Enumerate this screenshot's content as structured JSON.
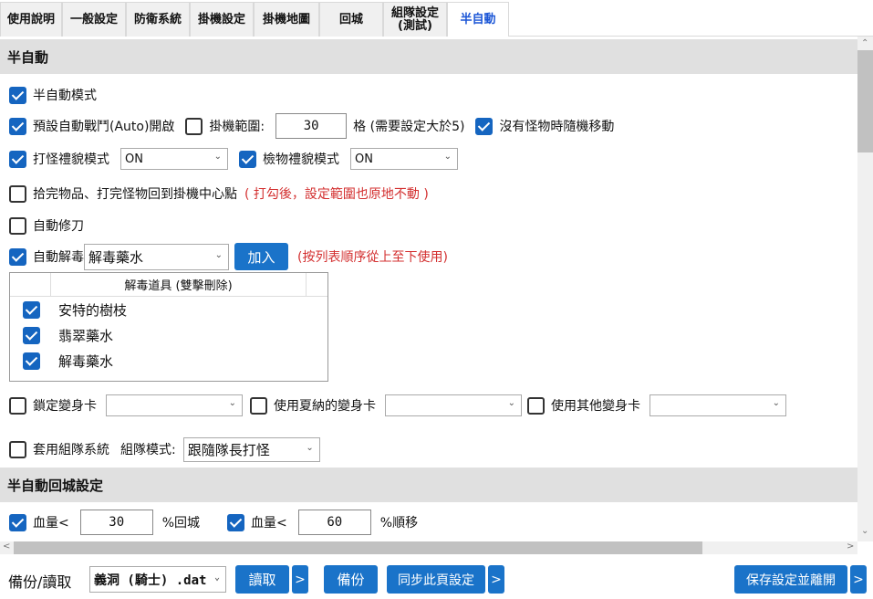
{
  "tabs": [
    {
      "label": "使用說明",
      "active": false
    },
    {
      "label": "一般設定",
      "active": false
    },
    {
      "label": "防衛系統",
      "active": false
    },
    {
      "label": "掛機設定",
      "active": false
    },
    {
      "label": "掛機地圖",
      "active": false
    },
    {
      "label": "回城",
      "active": false
    },
    {
      "label_line1": "組隊設定",
      "label_line2": "(測試)",
      "active": false
    },
    {
      "label": "半自動",
      "active": true
    }
  ],
  "section1": {
    "title": "半自動",
    "semi_auto_mode": {
      "label": "半自動模式",
      "checked": true
    },
    "default_auto_battle": {
      "label": "預設自動戰鬥(Auto)開啟",
      "checked": true
    },
    "idle_range": {
      "label": "掛機範圍:",
      "checked": false,
      "value": "30",
      "suffix": "格 (需要設定大於5)"
    },
    "random_move": {
      "label": "沒有怪物時隨機移動",
      "checked": true
    },
    "fight_courtesy": {
      "label": "打怪禮貌模式",
      "checked": true,
      "value": "ON"
    },
    "loot_courtesy": {
      "label": "檢物禮貌模式",
      "checked": true,
      "value": "ON"
    },
    "return_center": {
      "label": "拾完物品、打完怪物回到掛機中心點",
      "checked": false,
      "note": "( 打勾後，設定範圍也原地不動 )"
    },
    "auto_repair": {
      "label": "自動修刀",
      "checked": false
    },
    "auto_detox": {
      "label": "自動解毒",
      "checked": true,
      "selected": "解毒藥水",
      "add_button": "加入",
      "note": "(按列表順序從上至下使用)"
    },
    "detox_list": {
      "header": "解毒道具 (雙擊刪除)",
      "items": [
        {
          "name": "安特的樹枝",
          "checked": true
        },
        {
          "name": "翡翠藥水",
          "checked": true
        },
        {
          "name": "解毒藥水",
          "checked": true
        }
      ]
    },
    "lock_transform": {
      "label": "鎖定變身卡",
      "checked": false,
      "value": ""
    },
    "use_xia_transform": {
      "label": "使用夏納的變身卡",
      "checked": false,
      "value": ""
    },
    "use_other_transform": {
      "label": "使用其他變身卡",
      "checked": false,
      "value": ""
    },
    "party_system": {
      "label": "套用組隊系統",
      "checked": false,
      "mode_label": "組隊模式:",
      "mode_value": "跟隨隊長打怪"
    }
  },
  "section2": {
    "title": "半自動回城設定",
    "hp_return": {
      "label": "血量<",
      "checked": true,
      "value": "30",
      "suffix": "%回城"
    },
    "hp_move": {
      "label": "血量<",
      "checked": true,
      "value": "60",
      "suffix": "%順移"
    }
  },
  "bottom": {
    "backup_label": "備份/讀取",
    "file_value": "義洞 (騎士) .dat",
    "read_button": "讀取",
    "more_button": ">",
    "backup_button": "備份",
    "sync_button": "同步此頁設定",
    "save_exit_button": "保存設定並離開"
  },
  "colors": {
    "accent": "#1a73c9",
    "active_tab": "#1a55d6",
    "note_red": "#d32f2f",
    "section_bg": "#e0e0e0"
  }
}
